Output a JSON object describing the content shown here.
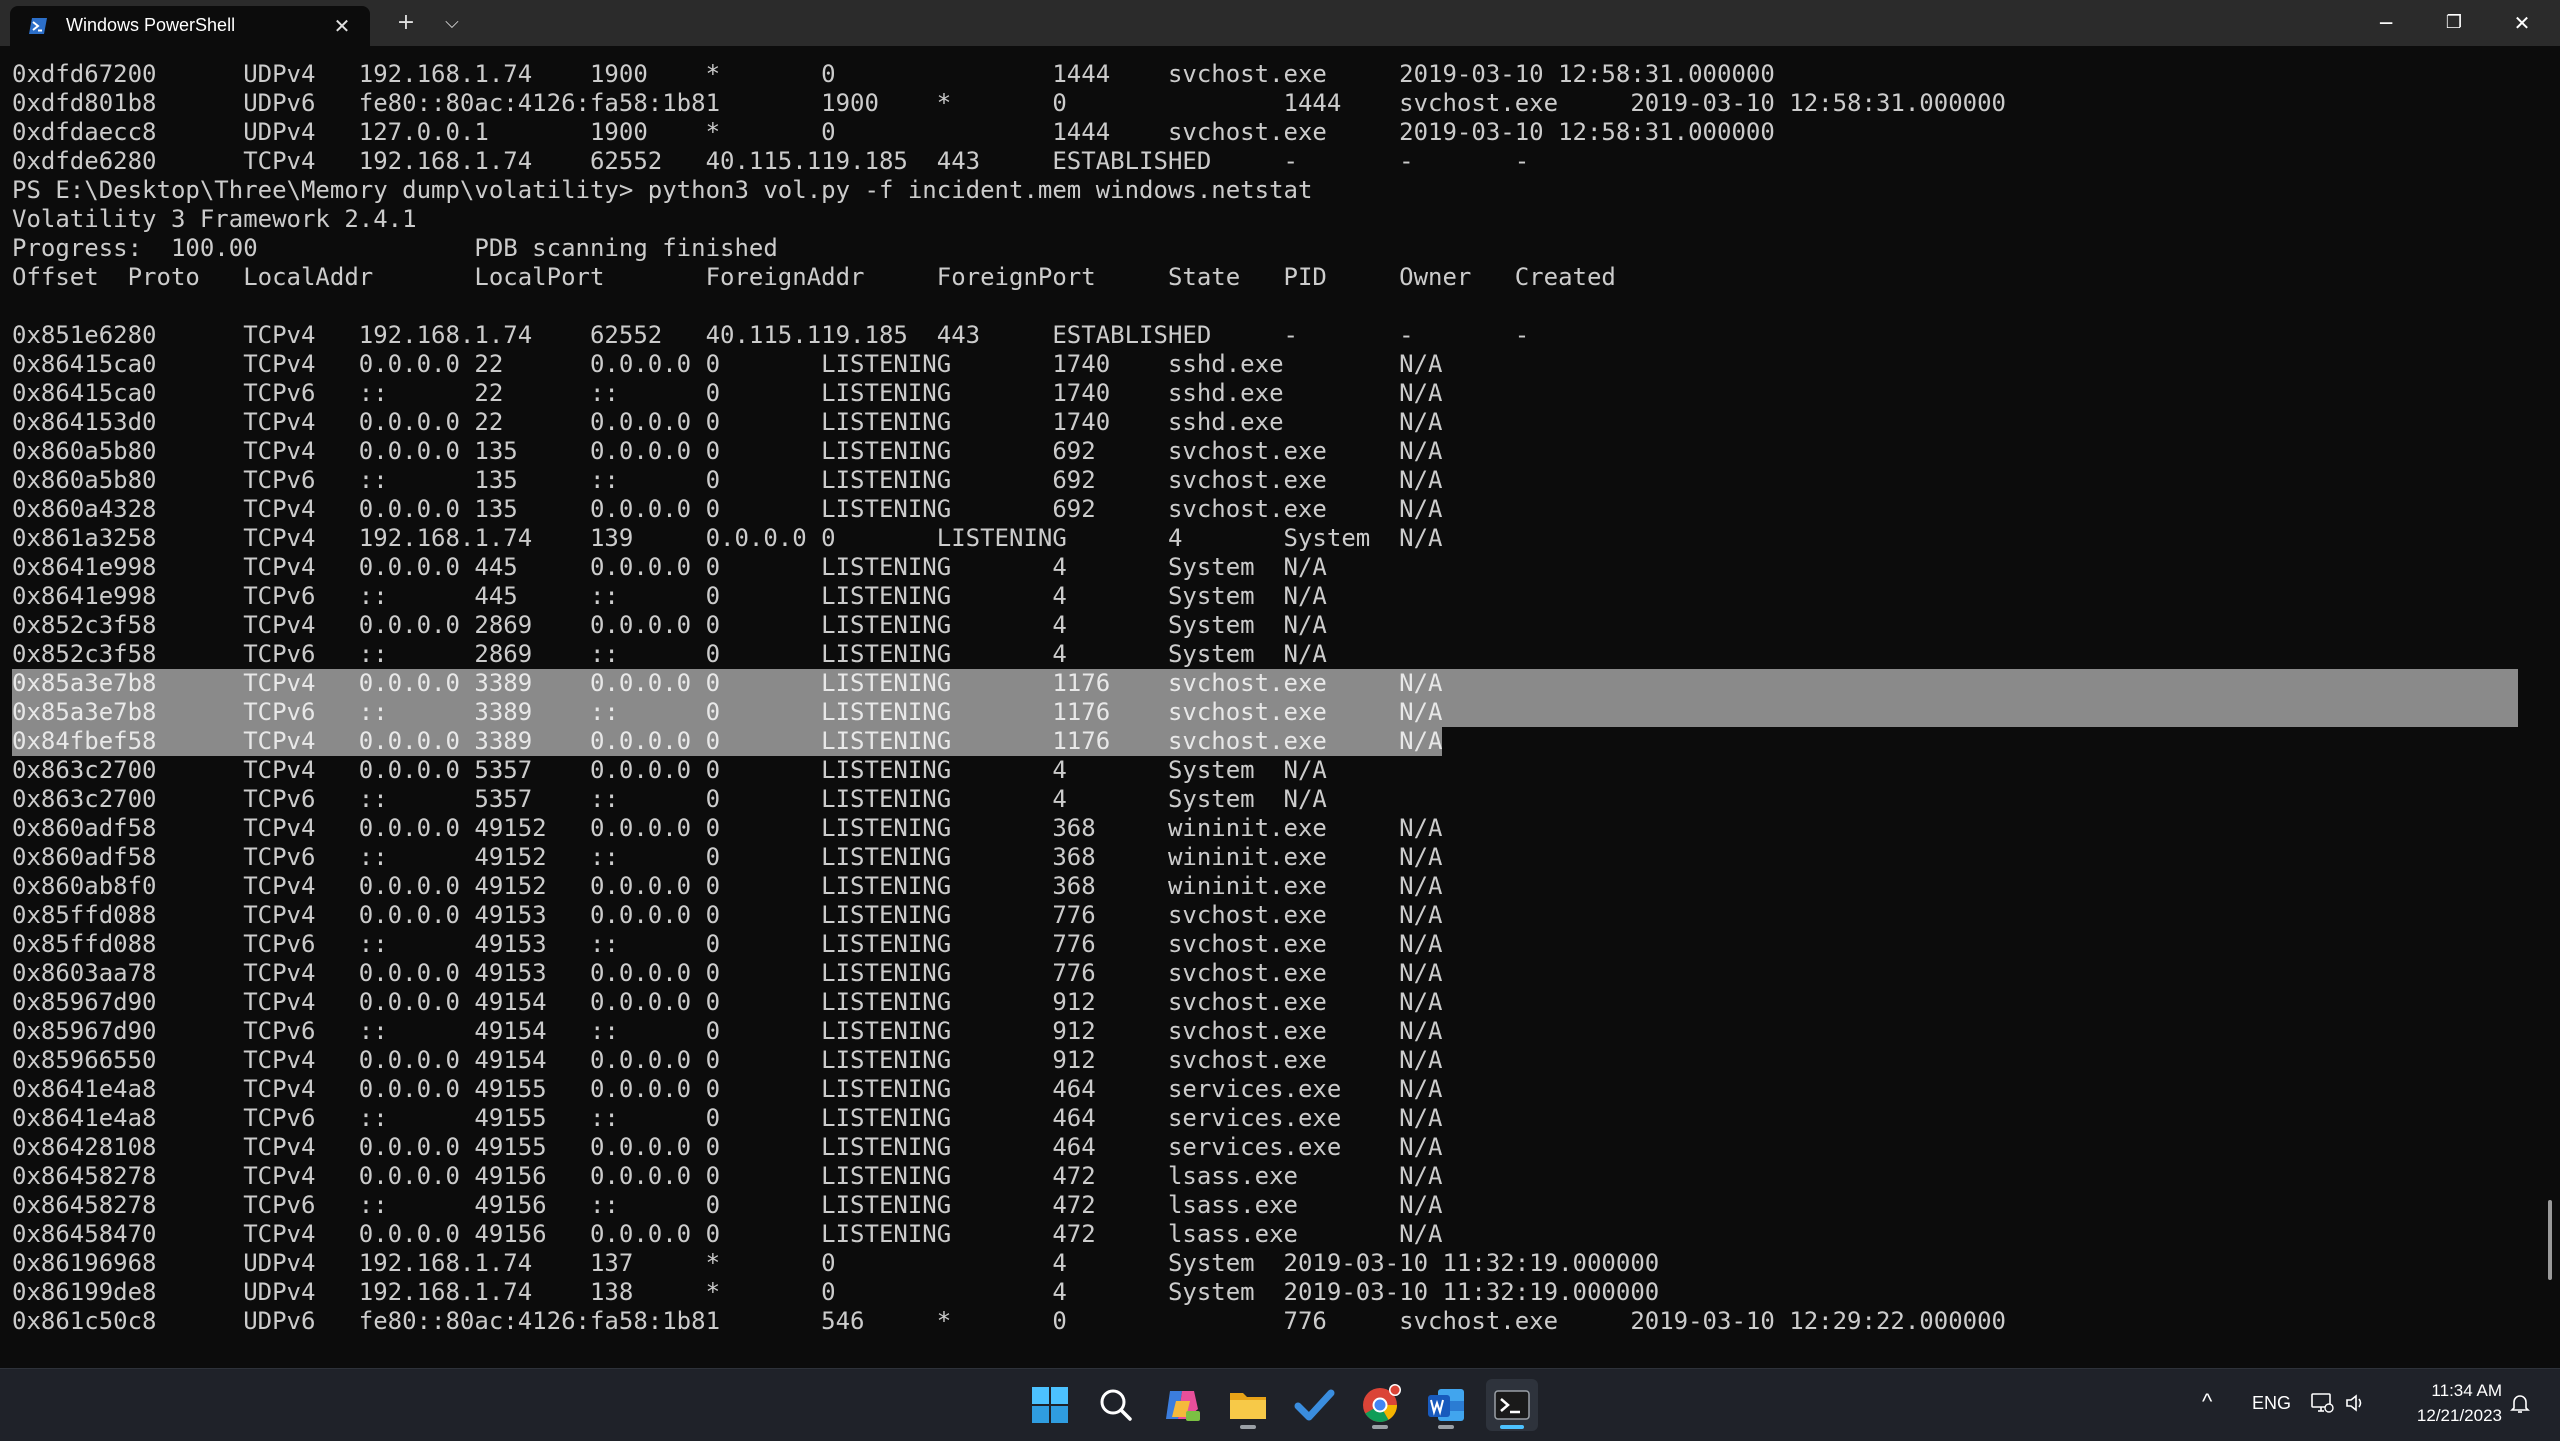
{
  "window": {
    "tab_title": "Windows PowerShell",
    "tab_close": "✕",
    "new_tab": "+",
    "dropdown": "⌵",
    "minimize": "─",
    "maximize": "❐",
    "close": "✕"
  },
  "terminal": {
    "lines": [
      "0xdfd67200      UDPv4   192.168.1.74    1900    *       0               1444    svchost.exe     2019-03-10 12:58:31.000000",
      "0xdfd801b8      UDPv6   fe80::80ac:4126:fa58:1b81       1900    *       0               1444    svchost.exe     2019-03-10 12:58:31.000000",
      "0xdfdaecc8      UDPv4   127.0.0.1       1900    *       0               1444    svchost.exe     2019-03-10 12:58:31.000000",
      "0xdfde6280      TCPv4   192.168.1.74    62552   40.115.119.185  443     ESTABLISHED     -       -       -",
      "PS E:\\Desktop\\Three\\Memory dump\\volatility> python3 vol.py -f incident.mem windows.netstat",
      "Volatility 3 Framework 2.4.1",
      "Progress:  100.00               PDB scanning finished",
      "Offset  Proto   LocalAddr       LocalPort       ForeignAddr     ForeignPort     State   PID     Owner   Created",
      "",
      "0x851e6280      TCPv4   192.168.1.74    62552   40.115.119.185  443     ESTABLISHED     -       -       -",
      "0x86415ca0      TCPv4   0.0.0.0 22      0.0.0.0 0       LISTENING       1740    sshd.exe        N/A",
      "0x86415ca0      TCPv6   ::      22      ::      0       LISTENING       1740    sshd.exe        N/A",
      "0x864153d0      TCPv4   0.0.0.0 22      0.0.0.0 0       LISTENING       1740    sshd.exe        N/A",
      "0x860a5b80      TCPv4   0.0.0.0 135     0.0.0.0 0       LISTENING       692     svchost.exe     N/A",
      "0x860a5b80      TCPv6   ::      135     ::      0       LISTENING       692     svchost.exe     N/A",
      "0x860a4328      TCPv4   0.0.0.0 135     0.0.0.0 0       LISTENING       692     svchost.exe     N/A",
      "0x861a3258      TCPv4   192.168.1.74    139     0.0.0.0 0       LISTENING       4       System  N/A",
      "0x8641e998      TCPv4   0.0.0.0 445     0.0.0.0 0       LISTENING       4       System  N/A",
      "0x8641e998      TCPv6   ::      445     ::      0       LISTENING       4       System  N/A",
      "0x852c3f58      TCPv4   0.0.0.0 2869    0.0.0.0 0       LISTENING       4       System  N/A",
      "0x852c3f58      TCPv6   ::      2869    ::      0       LISTENING       4       System  N/A",
      "0x85a3e7b8      TCPv4   0.0.0.0 3389    0.0.0.0 0       LISTENING       1176    svchost.exe     N/A",
      "0x85a3e7b8      TCPv6   ::      3389    ::      0       LISTENING       1176    svchost.exe     N/A",
      "0x84fbef58      TCPv4   0.0.0.0 3389    0.0.0.0 0       LISTENING       1176    svchost.exe     N/A",
      "0x863c2700      TCPv4   0.0.0.0 5357    0.0.0.0 0       LISTENING       4       System  N/A",
      "0x863c2700      TCPv6   ::      5357    ::      0       LISTENING       4       System  N/A",
      "0x860adf58      TCPv4   0.0.0.0 49152   0.0.0.0 0       LISTENING       368     wininit.exe     N/A",
      "0x860adf58      TCPv6   ::      49152   ::      0       LISTENING       368     wininit.exe     N/A",
      "0x860ab8f0      TCPv4   0.0.0.0 49152   0.0.0.0 0       LISTENING       368     wininit.exe     N/A",
      "0x85ffd088      TCPv4   0.0.0.0 49153   0.0.0.0 0       LISTENING       776     svchost.exe     N/A",
      "0x85ffd088      TCPv6   ::      49153   ::      0       LISTENING       776     svchost.exe     N/A",
      "0x8603aa78      TCPv4   0.0.0.0 49153   0.0.0.0 0       LISTENING       776     svchost.exe     N/A",
      "0x85967d90      TCPv4   0.0.0.0 49154   0.0.0.0 0       LISTENING       912     svchost.exe     N/A",
      "0x85967d90      TCPv6   ::      49154   ::      0       LISTENING       912     svchost.exe     N/A",
      "0x85966550      TCPv4   0.0.0.0 49154   0.0.0.0 0       LISTENING       912     svchost.exe     N/A",
      "0x8641e4a8      TCPv4   0.0.0.0 49155   0.0.0.0 0       LISTENING       464     services.exe    N/A",
      "0x8641e4a8      TCPv6   ::      49155   ::      0       LISTENING       464     services.exe    N/A",
      "0x86428108      TCPv4   0.0.0.0 49155   0.0.0.0 0       LISTENING       464     services.exe    N/A",
      "0x86458278      TCPv4   0.0.0.0 49156   0.0.0.0 0       LISTENING       472     lsass.exe       N/A",
      "0x86458278      TCPv6   ::      49156   ::      0       LISTENING       472     lsass.exe       N/A",
      "0x86458470      TCPv4   0.0.0.0 49156   0.0.0.0 0       LISTENING       472     lsass.exe       N/A",
      "0x86196968      UDPv4   192.168.1.74    137     *       0               4       System  2019-03-10 11:32:19.000000",
      "0x86199de8      UDPv4   192.168.1.74    138     *       0               4       System  2019-03-10 11:32:19.000000",
      "0x861c50c8      UDPv6   fe80::80ac:4126:fa58:1b81       546     *       0               776     svchost.exe     2019-03-10 12:29:22.000000"
    ],
    "selected_lines": [
      21,
      22,
      23
    ]
  },
  "taskbar": {
    "apps": [
      {
        "name": "start",
        "icon": "windows-logo"
      },
      {
        "name": "search",
        "icon": "search-icon"
      },
      {
        "name": "copilot",
        "icon": "copilot-icon"
      },
      {
        "name": "file-explorer",
        "icon": "folder-icon"
      },
      {
        "name": "todo",
        "icon": "checkmark-icon"
      },
      {
        "name": "chrome",
        "icon": "chrome-icon"
      },
      {
        "name": "word",
        "icon": "word-icon"
      },
      {
        "name": "terminal",
        "icon": "terminal-icon"
      }
    ],
    "tray": {
      "chevron": "^",
      "language": "ENG",
      "time": "11:34 AM",
      "date": "12/21/2023"
    }
  },
  "colors": {
    "terminal_bg": "#0c0c0c",
    "terminal_fg": "#cccccc",
    "selection": "#8a8a8a",
    "titlebar": "#2b2b2b",
    "taskbar": "#1f2229",
    "accent": "#4cc2ff"
  }
}
